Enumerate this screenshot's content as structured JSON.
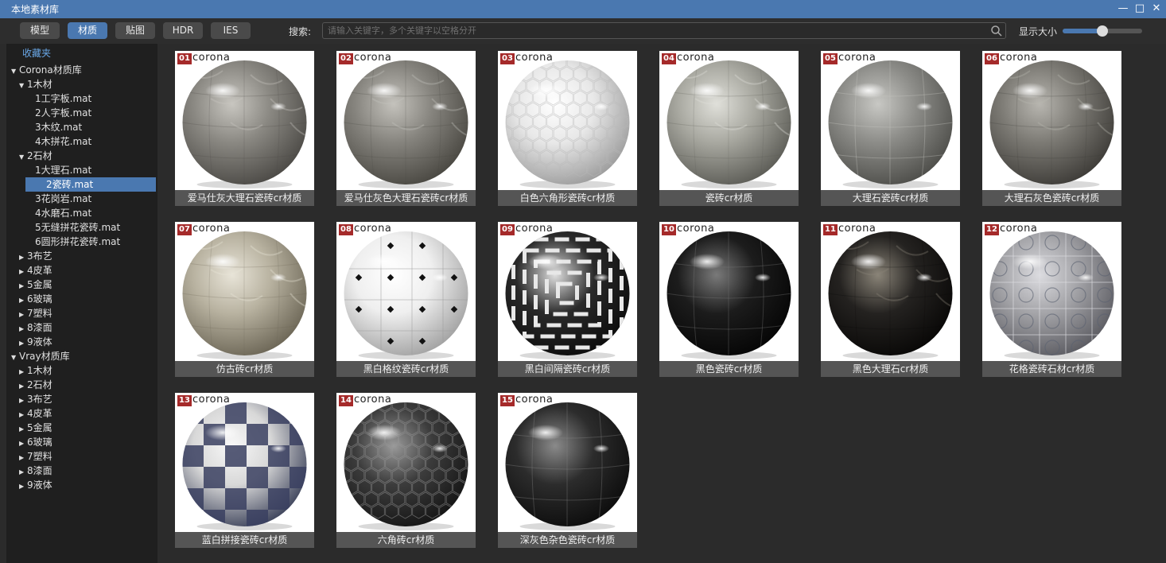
{
  "window": {
    "title": "本地素材库"
  },
  "toolbar": {
    "tabs": [
      {
        "label": "模型",
        "active": false
      },
      {
        "label": "材质",
        "active": true
      },
      {
        "label": "贴图",
        "active": false
      },
      {
        "label": "HDR",
        "active": false
      },
      {
        "label": "IES",
        "active": false
      }
    ],
    "search_label": "搜索:",
    "search_placeholder": "请输入关键字，多个关键字以空格分开",
    "search_value": "",
    "size_label": "显示大小",
    "size_value": 0.5
  },
  "sidebar": {
    "favorites": "收藏夹",
    "items": [
      {
        "label": "Corona材质库",
        "level": 0,
        "arrow": "▼",
        "selected": false
      },
      {
        "label": "1木材",
        "level": 1,
        "arrow": "▼",
        "selected": false
      },
      {
        "label": "1工字板.mat",
        "level": 2,
        "arrow": "",
        "selected": false
      },
      {
        "label": "2人字板.mat",
        "level": 2,
        "arrow": "",
        "selected": false
      },
      {
        "label": "3木纹.mat",
        "level": 2,
        "arrow": "",
        "selected": false
      },
      {
        "label": "4木拼花.mat",
        "level": 2,
        "arrow": "",
        "selected": false
      },
      {
        "label": "2石材",
        "level": 1,
        "arrow": "▼",
        "selected": false
      },
      {
        "label": "1大理石.mat",
        "level": 2,
        "arrow": "",
        "selected": false
      },
      {
        "label": "2瓷砖.mat",
        "level": 2,
        "arrow": "",
        "selected": true
      },
      {
        "label": "3花岗岩.mat",
        "level": 2,
        "arrow": "",
        "selected": false
      },
      {
        "label": "4水磨石.mat",
        "level": 2,
        "arrow": "",
        "selected": false
      },
      {
        "label": "5无缝拼花瓷砖.mat",
        "level": 2,
        "arrow": "",
        "selected": false
      },
      {
        "label": "6圆形拼花瓷砖.mat",
        "level": 2,
        "arrow": "",
        "selected": false
      },
      {
        "label": "3布艺",
        "level": 1,
        "arrow": "▶",
        "selected": false
      },
      {
        "label": "4皮革",
        "level": 1,
        "arrow": "▶",
        "selected": false
      },
      {
        "label": "5金属",
        "level": 1,
        "arrow": "▶",
        "selected": false
      },
      {
        "label": "6玻璃",
        "level": 1,
        "arrow": "▶",
        "selected": false
      },
      {
        "label": "7塑料",
        "level": 1,
        "arrow": "▶",
        "selected": false
      },
      {
        "label": "8漆面",
        "level": 1,
        "arrow": "▶",
        "selected": false
      },
      {
        "label": "9液体",
        "level": 1,
        "arrow": "▶",
        "selected": false
      },
      {
        "label": "Vray材质库",
        "level": 0,
        "arrow": "▼",
        "selected": false
      },
      {
        "label": "1木材",
        "level": 1,
        "arrow": "▶",
        "selected": false
      },
      {
        "label": "2石材",
        "level": 1,
        "arrow": "▶",
        "selected": false
      },
      {
        "label": "3布艺",
        "level": 1,
        "arrow": "▶",
        "selected": false
      },
      {
        "label": "4皮革",
        "level": 1,
        "arrow": "▶",
        "selected": false
      },
      {
        "label": "5金属",
        "level": 1,
        "arrow": "▶",
        "selected": false
      },
      {
        "label": "6玻璃",
        "level": 1,
        "arrow": "▶",
        "selected": false
      },
      {
        "label": "7塑料",
        "level": 1,
        "arrow": "▶",
        "selected": false
      },
      {
        "label": "8漆面",
        "level": 1,
        "arrow": "▶",
        "selected": false
      },
      {
        "label": "9液体",
        "level": 1,
        "arrow": "▶",
        "selected": false
      }
    ]
  },
  "materials": {
    "brand": "corona",
    "items": [
      {
        "num": "01",
        "caption": "爱马仕灰大理石瓷砖cr材质",
        "base": "#8a8882",
        "dark": "#4a4844",
        "light": "#c8c6c0",
        "pattern": "marble"
      },
      {
        "num": "02",
        "caption": "爱马仕灰色大理石瓷砖cr材质",
        "base": "#86847e",
        "dark": "#484640",
        "light": "#c4c2bc",
        "pattern": "marble"
      },
      {
        "num": "03",
        "caption": "白色六角形瓷砖cr材质",
        "base": "#e8e8e8",
        "dark": "#9a9a9a",
        "light": "#ffffff",
        "pattern": "hex"
      },
      {
        "num": "04",
        "caption": "瓷砖cr材质",
        "base": "#a8a8a0",
        "dark": "#5a5a54",
        "light": "#e0e0da",
        "pattern": "marble"
      },
      {
        "num": "05",
        "caption": "大理石瓷砖cr材质",
        "base": "#8c8c88",
        "dark": "#4c4c48",
        "light": "#c8c8c4",
        "pattern": "tile"
      },
      {
        "num": "06",
        "caption": "大理石灰色瓷砖cr材质",
        "base": "#7c7a74",
        "dark": "#3c3a36",
        "light": "#b8b6b0",
        "pattern": "marble"
      },
      {
        "num": "07",
        "caption": "仿古砖cr材质",
        "base": "#b8b2a0",
        "dark": "#6a6454",
        "light": "#e8e4d8",
        "pattern": "marble"
      },
      {
        "num": "08",
        "caption": "黑白格纹瓷砖cr材质",
        "base": "#efefef",
        "dark": "#a0a0a0",
        "light": "#ffffff",
        "pattern": "dots"
      },
      {
        "num": "09",
        "caption": "黑白间隔瓷砖cr材质",
        "base": "#2a2a2a",
        "dark": "#0c0c0c",
        "light": "#e0e0e0",
        "pattern": "maze"
      },
      {
        "num": "10",
        "caption": "黑色瓷砖cr材质",
        "base": "#1c1c1c",
        "dark": "#050505",
        "light": "#7a7a7a",
        "pattern": "tile"
      },
      {
        "num": "11",
        "caption": "黑色大理石cr材质",
        "base": "#242220",
        "dark": "#080706",
        "light": "#8a8478",
        "pattern": "marble"
      },
      {
        "num": "12",
        "caption": "花格瓷砖石材cr材质",
        "base": "#a4a4a8",
        "dark": "#5a5a60",
        "light": "#dcdce0",
        "pattern": "ornate"
      },
      {
        "num": "13",
        "caption": "蓝白拼接瓷砖cr材质",
        "base": "#d8d8d8",
        "dark": "#3a4058",
        "light": "#f8f8f8",
        "pattern": "check"
      },
      {
        "num": "14",
        "caption": "六角砖cr材质",
        "base": "#3c3c3c",
        "dark": "#141414",
        "light": "#9a9a9a",
        "pattern": "hex"
      },
      {
        "num": "15",
        "caption": "深灰色杂色瓷砖cr材质",
        "base": "#2c2c2c",
        "dark": "#0c0c0c",
        "light": "#8a8a8a",
        "pattern": "tile"
      }
    ]
  }
}
